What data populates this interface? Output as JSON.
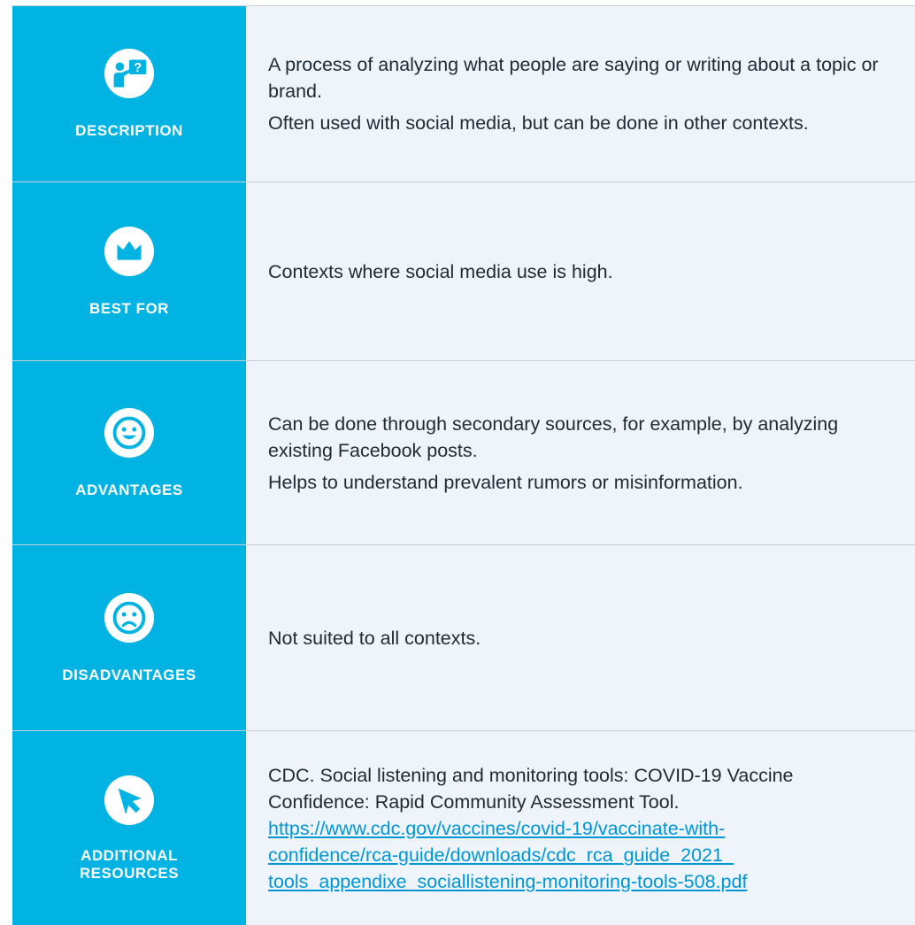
{
  "rows": [
    {
      "label": "DESCRIPTION",
      "icon": "presenter-question-icon",
      "paragraphs": [
        "A process of analyzing what people are saying or writing about a topic or brand.",
        "Often used with social media, but can be done in other contexts."
      ]
    },
    {
      "label": "BEST FOR",
      "icon": "crown-icon",
      "paragraphs": [
        "Contexts where social media use is high."
      ]
    },
    {
      "label": "ADVANTAGES",
      "icon": "smiley-face-icon",
      "paragraphs": [
        "Can be done through secondary sources, for example, by analyzing existing Facebook posts.",
        "Helps to understand prevalent rumors or misinformation."
      ]
    },
    {
      "label": "DISADVANTAGES",
      "icon": "sad-face-icon",
      "paragraphs": [
        "Not suited to all contexts."
      ]
    },
    {
      "label_line1": "ADDITIONAL",
      "label_line2": "RESOURCES",
      "icon": "cursor-arrow-icon",
      "citation": "CDC. Social listening and monitoring tools: COVID-19 Vaccine Confidence: Rapid Community Assessment Tool.",
      "link_line1": "https://www.cdc.gov/vaccines/covid-19/vaccinate-with-",
      "link_line2": "confidence/rca-guide/downloads/cdc_rca_guide_2021_",
      "link_line3": "tools_appendixe_sociallistening-monitoring-tools-508.pdf"
    }
  ],
  "colors": {
    "accent": "#00b3e3",
    "content_bg": "#eef4f9",
    "text": "#1f2a33",
    "link": "#0096d6",
    "divider": "#c9d1d8"
  }
}
